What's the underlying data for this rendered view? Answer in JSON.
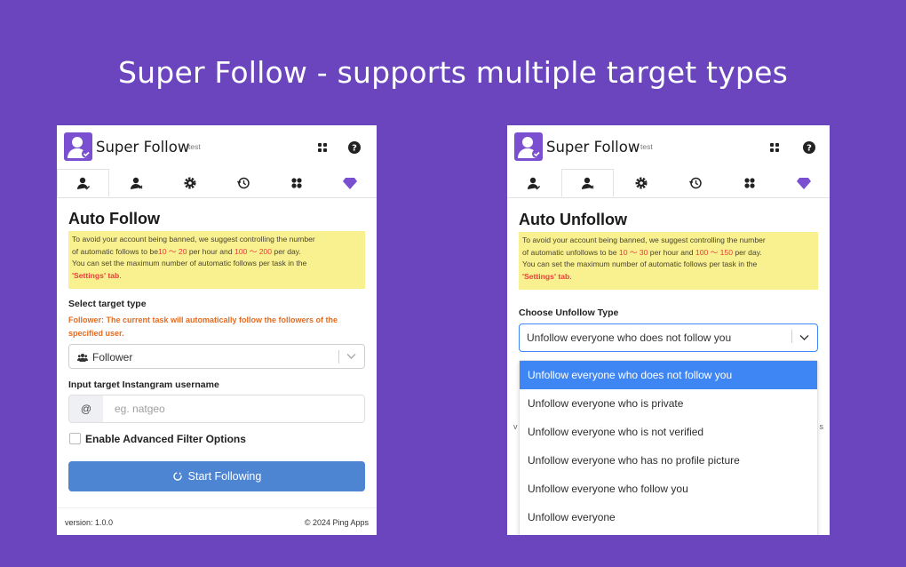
{
  "banner": {
    "title": "Super Follow - supports multiple target types"
  },
  "panel_follow": {
    "app_title": "Super Follow",
    "badge": "test",
    "heading": "Auto Follow",
    "notice": {
      "line1": "To avoid your account being banned, we suggest controlling the number",
      "line2_a": "of automatic follows to be",
      "line2_hl1": "10 ～ 20",
      "line2_b": " per hour and ",
      "line2_hl2": "100 ～ 200",
      "line2_c": " per day.",
      "line3": "You can set the maximum number of automatic follows per task in the",
      "line4_hl": "'Settings' tab",
      "line4_end": "."
    },
    "target_label": "Select target type",
    "target_hint": "Follower: The current task will automatically follow the followers of the specified user.",
    "target_value": "Follower",
    "username_label": "Input target Instangram username",
    "at_addon": "@",
    "username_placeholder": "eg. natgeo",
    "advanced_label": "Enable Advanced Filter Options",
    "start_button": "Start Following",
    "version": "version: 1.0.0",
    "copyright": "© 2024 Ping Apps"
  },
  "panel_unfollow": {
    "app_title": "Super Follow",
    "badge": "test",
    "heading": "Auto Unfollow",
    "notice": {
      "line1": "To avoid your account being banned, we suggest controlling the number",
      "line2_a": "of automatic unfollows to be ",
      "line2_hl1": "10 ～ 30",
      "line2_b": " per hour and ",
      "line2_hl2": "100 ～ 150",
      "line2_c": " per day.",
      "line3": "You can set the maximum number of automatic follows per task in the",
      "line4_hl": "'Settings' tab",
      "line4_end": "."
    },
    "type_label": "Choose Unfollow Type",
    "type_value": "Unfollow everyone who does not follow you",
    "options": [
      "Unfollow everyone who does not follow you",
      "Unfollow everyone who is private",
      "Unfollow everyone who is not verified",
      "Unfollow everyone who has no profile picture",
      "Unfollow everyone who follow you",
      "Unfollow everyone"
    ],
    "selected_index": 0
  },
  "colors": {
    "background": "#6a45bd",
    "accent_purple": "#7a4fd0",
    "primary_button": "#4d85d3",
    "notice_bg": "#f9f08f",
    "highlight_red": "#e7403b",
    "hint_orange": "#e46b20",
    "selected_option": "#3f86f5"
  },
  "icons": {
    "logo": "user-check-logo",
    "header": [
      "apps-grid-icon",
      "help-circle-icon"
    ],
    "tabs": [
      "user-check-icon",
      "user-x-icon",
      "gear-icon",
      "history-icon",
      "apps-icon",
      "diamond-icon"
    ]
  }
}
